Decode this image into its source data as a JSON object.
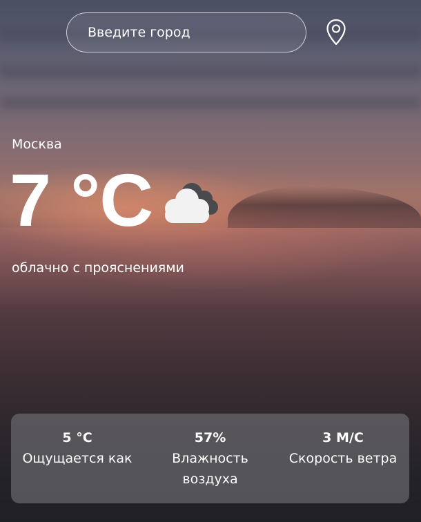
{
  "search": {
    "placeholder": "Введите город"
  },
  "icons": {
    "location": "map-pin-icon",
    "weather": "cloud-icon"
  },
  "weather": {
    "city": "Москва",
    "temperature": "7 °C",
    "description": "облачно с прояснениями"
  },
  "details": [
    {
      "value": "5 °C",
      "label": "Ощущается как"
    },
    {
      "value": "57%",
      "label": "Влажность воздуха"
    },
    {
      "value": "3 М/С",
      "label": "Скорость ветра"
    }
  ],
  "colors": {
    "text": "#ffffff",
    "panel": "rgba(115,115,120,0.62)",
    "cloud_front": "#f2f2f2",
    "cloud_back": "#4a4a4e"
  }
}
